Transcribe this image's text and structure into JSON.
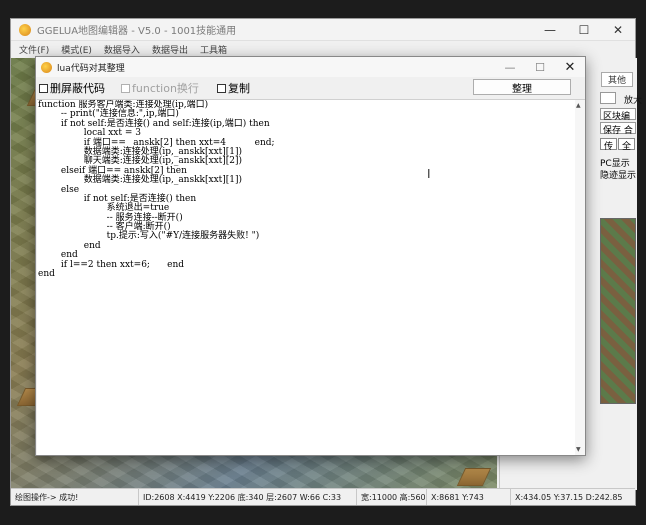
{
  "main_window": {
    "title": "GGELUA地图编辑器 - V5.0 - 1001技能通用",
    "controls": {
      "minimize": "—",
      "maximize": "☐",
      "close": "✕"
    },
    "menu": [
      "文件(F)",
      "模式(E)",
      "数据导入",
      "数据导出",
      "工具箱"
    ]
  },
  "right_panel": {
    "tab_other": "其他",
    "zoom_label": "放大",
    "select_1": "",
    "select_2": "区块编",
    "select_3": "保存 合",
    "mini_tab_1": "传",
    "mini_tab_2": "全",
    "check_1": "PC显示",
    "check_2": "隐迹显示"
  },
  "dialog": {
    "title": "lua代码对其整理",
    "controls": {
      "minimize": "—",
      "maximize": "☐",
      "close": "✕"
    },
    "check_strip": "删屏蔽代码",
    "check_function": "function换行",
    "check_copy": "复制",
    "format_button": "整理",
    "code_lines": [
      "function 服务客户端类:连接处理(ip,端口)",
      "        -- print(\"连接信息:\",ip,端口)",
      "        if not self:是否连接() and self:连接(ip,端口) then",
      "                local xxt = 3",
      "                if 端口== _anskk[2] then xxt=4          end;",
      "                数据端类:连接处理(ip,_anskk[xxt][1])",
      "                聊天端类:连接处理(ip,_anskk[xxt][2])",
      "        elseif 端口== anskk[2] then",
      "                数据端类:连接处理(ip,_anskk[xxt][1])",
      "        else",
      "                if not self:是否连接() then",
      "                        系统退出=true",
      "                        -- 服务连接--断开()",
      "                        -- 客户端:断开()",
      "                        tp.提示:写入(\"#Y/连接服务器失败! \")",
      "                end",
      "        end",
      "        if l==2 then xxt=6;      end",
      "end"
    ]
  },
  "status_bar": {
    "message": "绘图操作-> 成功!",
    "seg_1": "ID:2608 X:4419 Y:2206 底:340 层:2607 W:66 C:33",
    "seg_2": "宽:11000 高:5600",
    "seg_3": "X:8681 Y:743",
    "seg_4": "X:434.05 Y:37.15 D:242.85"
  }
}
